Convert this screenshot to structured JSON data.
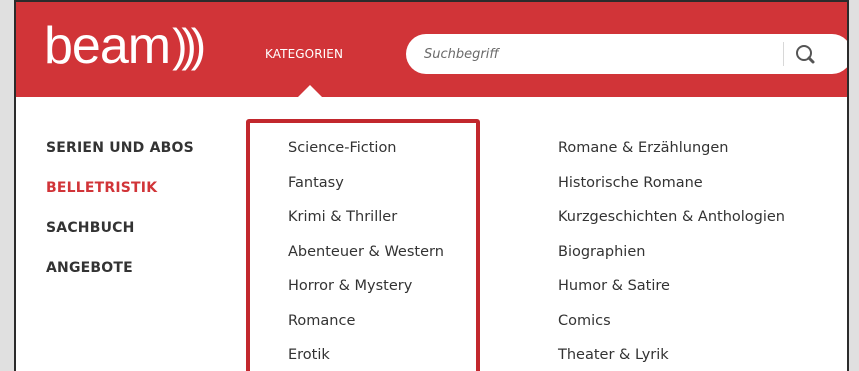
{
  "header": {
    "logo_text": "beam",
    "logo_waves": ")))",
    "nav_label": "KATEGORIEN",
    "search_placeholder": "Suchbegriff",
    "search_icon": "search-icon"
  },
  "menu": {
    "primary": [
      {
        "label": "SERIEN UND ABOS",
        "active": false
      },
      {
        "label": "BELLETRISTIK",
        "active": true
      },
      {
        "label": "SACHBUCH",
        "active": false
      },
      {
        "label": "ANGEBOTE",
        "active": false
      }
    ],
    "genres_col1": [
      "Science-Fiction",
      "Fantasy",
      "Krimi & Thriller",
      "Abenteuer & Western",
      "Horror & Mystery",
      "Romance",
      "Erotik"
    ],
    "genres_col2": [
      "Romane & Erzählungen",
      "Historische Romane",
      "Kurzgeschichten & Anthologien",
      "Biographien",
      "Humor & Satire",
      "Comics",
      "Theater & Lyrik"
    ]
  },
  "colors": {
    "brand_red": "#d13438",
    "highlight_red": "#c2272d",
    "text": "#333333",
    "active": "#d13438"
  }
}
